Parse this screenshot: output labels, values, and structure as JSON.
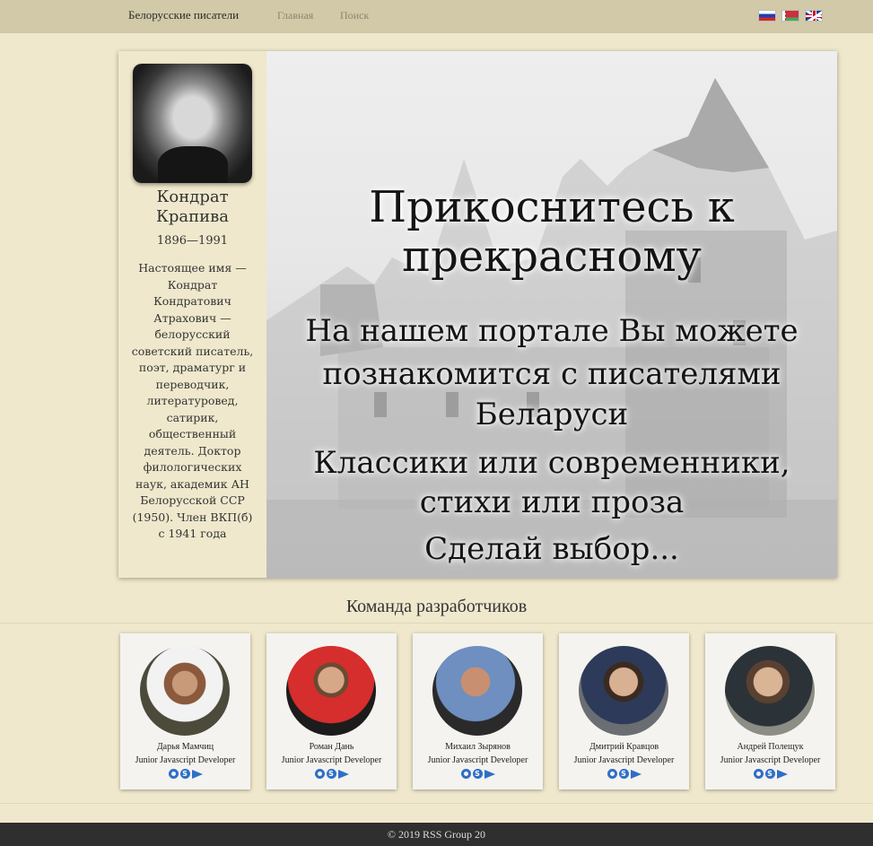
{
  "navbar": {
    "brand": "Белорусские писатели",
    "links": [
      "Главная",
      "Поиск"
    ],
    "languages": [
      "ru-flag-icon",
      "by-flag-icon",
      "uk-flag-icon"
    ]
  },
  "author": {
    "name": "Кондрат Крапива",
    "years": "1896—1991",
    "bio": "Настоящее имя — Кондрат Кондратович Атрахович — белорусский советский писатель, поэт, драматург и переводчик, литературовед, сатирик, общественный деятель. Доктор филологических наук, академик АН Белорусской ССР (1950). Член ВКП(б) с 1941 года"
  },
  "banner": {
    "title": "Прикоснитесь к прекрасному",
    "lines": [
      "На нашем портале Вы можете",
      "познакомится с писателями",
      "Беларуси",
      "Классики или современники,",
      "стихи или проза",
      "Сделай выбор..."
    ]
  },
  "team": {
    "title": "Команда разработчиков",
    "members": [
      {
        "name": "Дарья Мамчиц",
        "role": "Junior Javascript Developer"
      },
      {
        "name": "Роман Дань",
        "role": "Junior Javascript Developer"
      },
      {
        "name": "Михаил Зырянов",
        "role": "Junior Javascript Developer"
      },
      {
        "name": "Дмитрий Кравцов",
        "role": "Junior Javascript Developer"
      },
      {
        "name": "Андрей Полещук",
        "role": "Junior Javascript Developer"
      }
    ],
    "icons": [
      "github-icon",
      "skype-icon",
      "telegram-icon"
    ]
  },
  "footer": {
    "text": "© 2019 RSS Group 20"
  }
}
